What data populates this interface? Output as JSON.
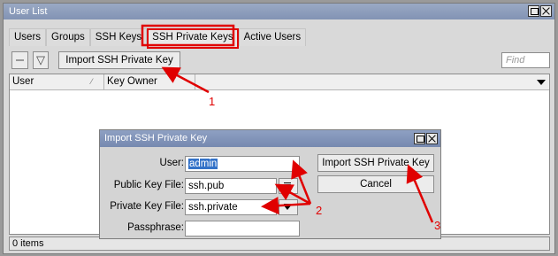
{
  "window": {
    "title": "User List"
  },
  "tabs": [
    {
      "label": "Users"
    },
    {
      "label": "Groups"
    },
    {
      "label": "SSH Keys"
    },
    {
      "label": "SSH Private Keys"
    },
    {
      "label": "Active Users"
    }
  ],
  "toolbar": {
    "import_label": "Import SSH Private Key",
    "find_placeholder": "Find"
  },
  "table": {
    "columns": [
      "User",
      "Key Owner"
    ]
  },
  "status": {
    "count": "0 items"
  },
  "dialog": {
    "title": "Import SSH Private Key",
    "fields": {
      "user_label": "User:",
      "user_value": "admin",
      "public_key_label": "Public Key File:",
      "public_key_value": "ssh.pub",
      "private_key_label": "Private Key File:",
      "private_key_value": "ssh.private",
      "passphrase_label": "Passphrase:",
      "passphrase_value": ""
    },
    "buttons": {
      "import": "Import SSH Private Key",
      "cancel": "Cancel"
    }
  },
  "annotations": {
    "step1": "1",
    "step2": "2",
    "step3": "3",
    "color": "#e00000"
  }
}
